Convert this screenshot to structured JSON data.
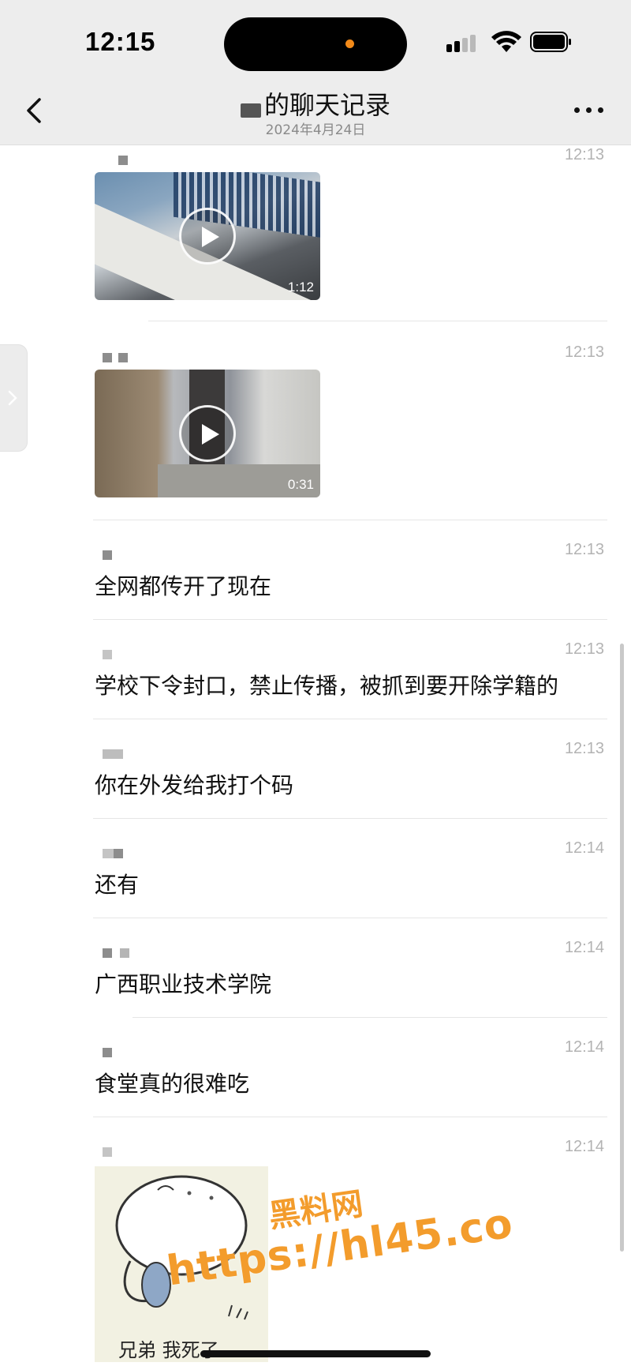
{
  "status_bar": {
    "time": "12:15",
    "accent_color": "#f28a19"
  },
  "nav": {
    "title": "的聊天记录",
    "date": "2024年4月24日"
  },
  "messages": [
    {
      "type": "video",
      "time": "12:13",
      "duration": "1:12"
    },
    {
      "type": "video",
      "time": "12:13",
      "duration": "0:31"
    },
    {
      "type": "text",
      "time": "12:13",
      "text": "全网都传开了现在"
    },
    {
      "type": "text",
      "time": "12:13",
      "text": "学校下令封口，禁止传播，被抓到要开除学籍的"
    },
    {
      "type": "text",
      "time": "12:13",
      "text": "你在外发给我打个码"
    },
    {
      "type": "text",
      "time": "12:14",
      "text": "还有"
    },
    {
      "type": "text",
      "time": "12:14",
      "text": "广西职业技术学院"
    },
    {
      "type": "text",
      "time": "12:14",
      "text": "食堂真的很难吃"
    },
    {
      "type": "sticker",
      "time": "12:14",
      "caption": "兄弟 我死了"
    }
  ],
  "watermark": {
    "line1": "黑料网",
    "line2": "https://hl45.co",
    "color": "#f39c2c"
  },
  "icons": [
    "back-chevron-icon",
    "more-dots-icon",
    "play-icon",
    "wifi-icon",
    "signal-icon",
    "battery-icon",
    "side-expand-chevron-icon"
  ]
}
